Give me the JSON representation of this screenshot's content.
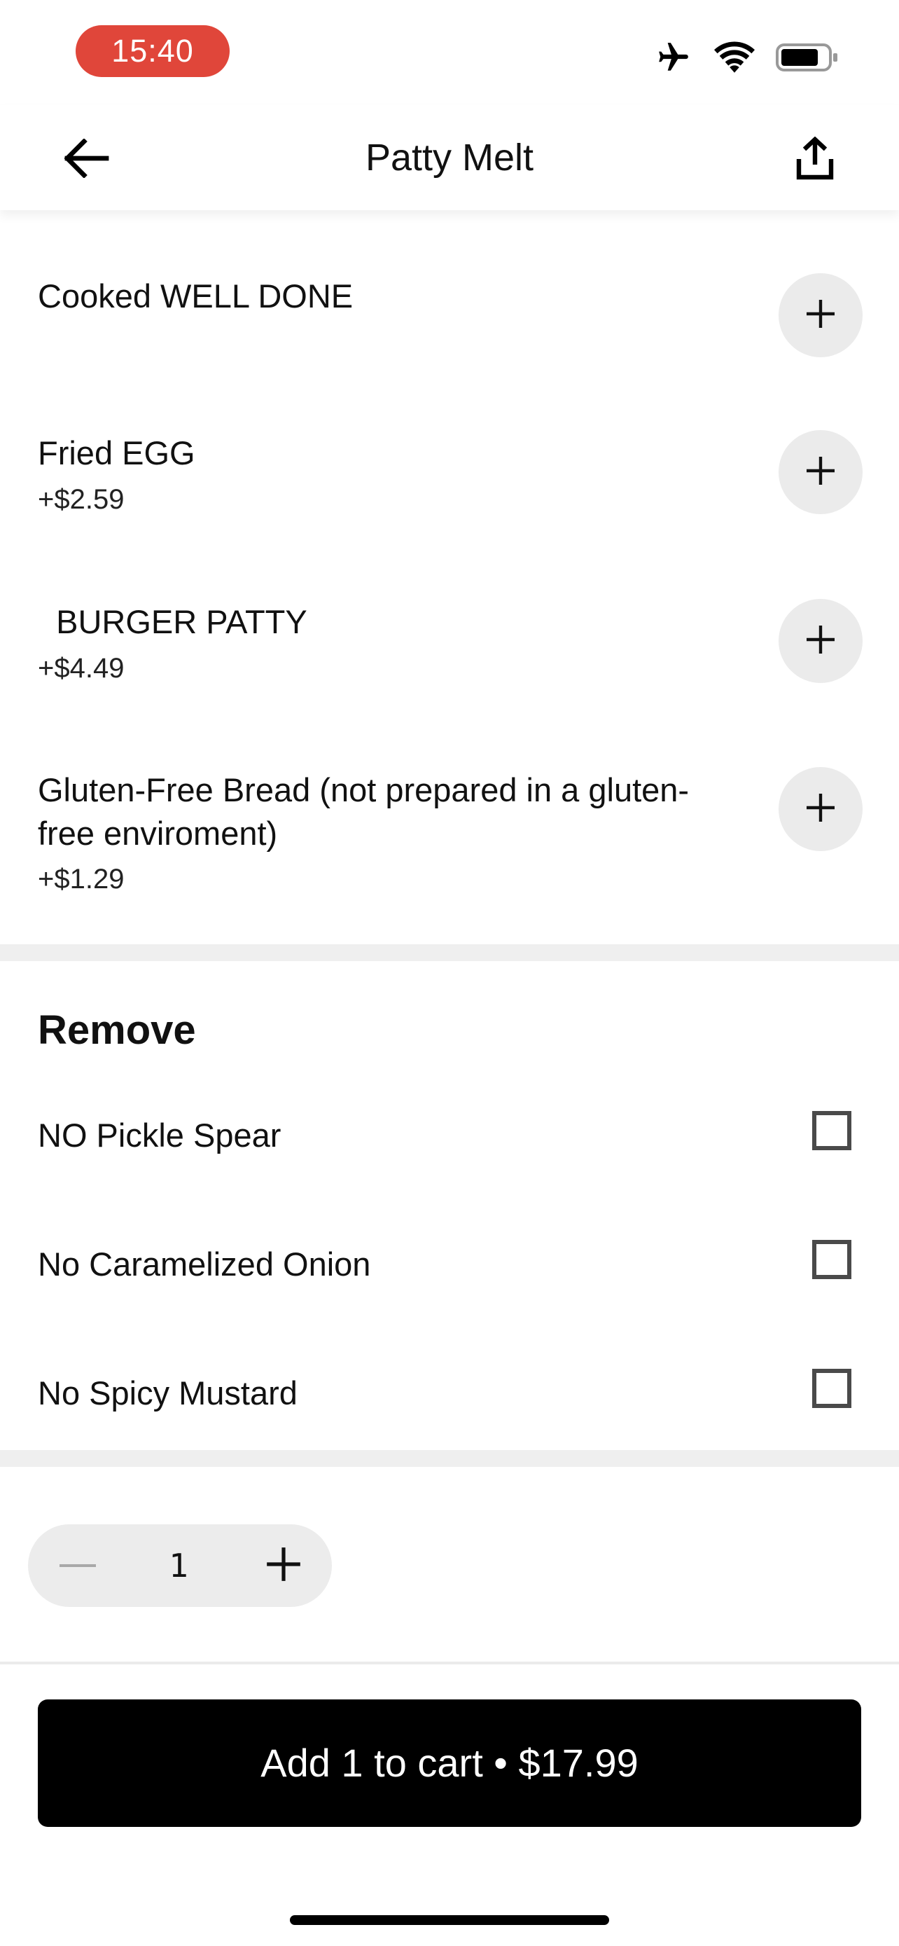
{
  "status_bar": {
    "time": "15:40",
    "icons": [
      "airplane-mode-icon",
      "wifi-icon",
      "battery-icon"
    ],
    "time_pill_color": "#e0463a"
  },
  "nav": {
    "title": "Patty Melt",
    "back_icon": "back-arrow-icon",
    "share_icon": "share-icon"
  },
  "addons": [
    {
      "name": "Cooked WELL DONE",
      "price": ""
    },
    {
      "name": "Fried EGG",
      "price": "+$2.59"
    },
    {
      "name": "  BURGER PATTY",
      "price": "+$4.49"
    },
    {
      "name": "Gluten-Free Bread (not prepared in a gluten-free enviroment)",
      "price": "+$1.29"
    }
  ],
  "remove_section": {
    "title": "Remove",
    "items": [
      {
        "label": "NO Pickle Spear",
        "checked": false
      },
      {
        "label": "No Caramelized Onion",
        "checked": false
      },
      {
        "label": "No Spicy Mustard",
        "checked": false
      }
    ]
  },
  "quantity": {
    "value": "1"
  },
  "cart_button": {
    "label": "Add 1 to cart • $17.99"
  }
}
